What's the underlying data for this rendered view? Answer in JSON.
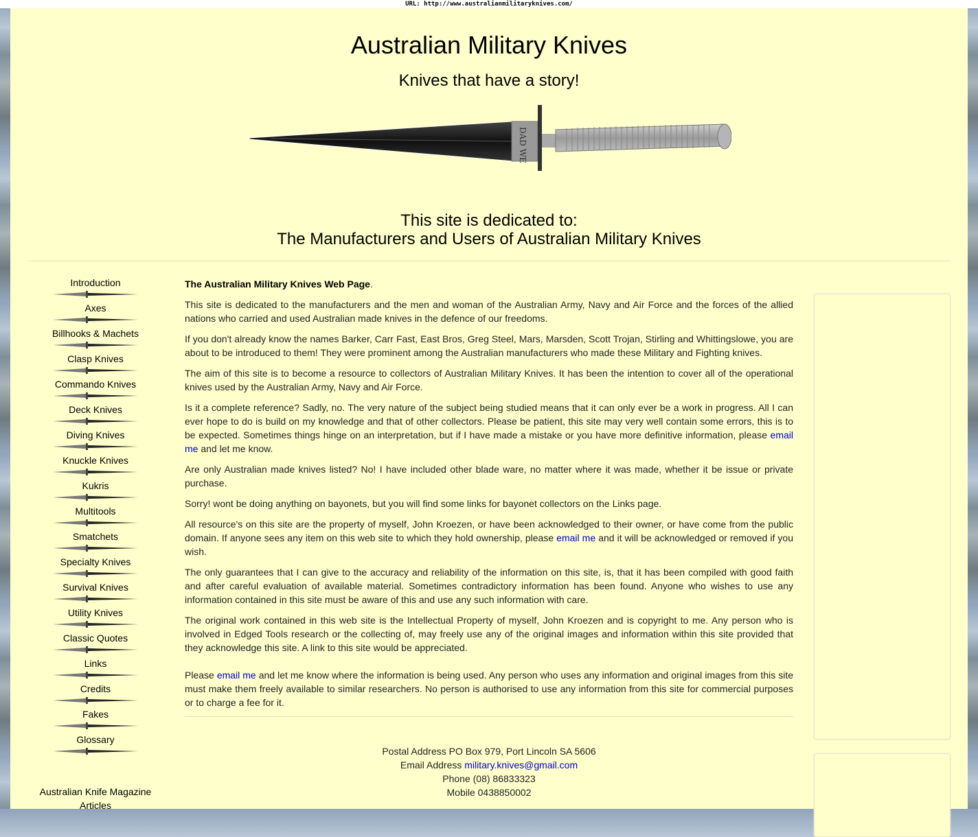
{
  "url_bar": "URL: http://www.australianmilitaryknives.com/",
  "header": {
    "title": "Australian Military Knives",
    "subtitle": "Knives that have a story!",
    "knife_etching": "DAD WE",
    "dedication_line1": "This site is dedicated to:",
    "dedication_line2": "The Manufacturers and Users of Australian Military Knives"
  },
  "sidebar": {
    "items": [
      {
        "label": "Introduction"
      },
      {
        "label": "Axes"
      },
      {
        "label": "Billhooks & Machets"
      },
      {
        "label": "Clasp Knives"
      },
      {
        "label": "Commando Knives"
      },
      {
        "label": "Deck Knives"
      },
      {
        "label": "Diving Knives"
      },
      {
        "label": "Knuckle Knives"
      },
      {
        "label": "Kukris"
      },
      {
        "label": "Multitools"
      },
      {
        "label": "Smatchets"
      },
      {
        "label": "Specialty Knives"
      },
      {
        "label": "Survival Knives"
      },
      {
        "label": "Utility Knives"
      },
      {
        "label": "Classic Quotes"
      },
      {
        "label": "Links"
      },
      {
        "label": "Credits"
      },
      {
        "label": "Fakes"
      },
      {
        "label": "Glossary"
      }
    ],
    "extra_link": "Australian Knife Magazine Articles"
  },
  "content": {
    "intro_bold": "The Australian Military Knives Web Page",
    "intro_dot": ".",
    "p1": "This site is dedicated to the manufacturers and the men and woman of the Australian Army, Navy and Air Force and the forces of the allied nations who carried and used Australian made knives in the defence of our freedoms.",
    "p2": "If you don't already know the names Barker, Carr Fast, East Bros, Greg Steel, Mars, Marsden, Scott Trojan, Stirling and Whittingslowe, you are about to be introduced to them! They were prominent among the Australian manufacturers who made these Military and Fighting knives.",
    "p3": "The aim of this site is to become a resource to collectors of Australian Military Knives. It has been the intention to cover all of the operational knives used by the Australian Army, Navy and Air Force.",
    "p4_pre": "Is it a complete reference? Sadly, no. The very nature of the subject being studied means that it can only ever be a work in progress. All I can ever hope to do is build on my knowledge and that of other collectors. Please be patient, this site may very well contain some errors, this is to be expected. Sometimes things hinge on an interpretation, but if I have made a mistake or you have more definitive information, please ",
    "p4_link": "email me",
    "p4_post": " and let me know.",
    "p5": "Are only Australian made knives listed? No! I have included other blade ware, no matter where it was made, whether it be issue or private purchase.",
    "p6": "Sorry! wont be doing anything on bayonets, but you will find some links for bayonet collectors on the Links page.",
    "p7_pre": "All resource's on this site are the property of myself, John Kroezen, or have been acknowledged to their owner, or have come from the public domain. If anyone sees any item on this web site to which they hold ownership, please ",
    "p7_link": "email me",
    "p7_post": " and it will be acknowledged or removed if you wish.",
    "p8": "The only guarantees that I can give to the accuracy and reliability of the information on this site, is, that it has been compiled with good faith and after careful evaluation of available material. Sometimes contradictory information has been found. Anyone who wishes to use any information contained in this site must be aware of this and use any such information with care.",
    "p9": "The original work contained in this web site is the Intellectual Property of myself, John Kroezen and is copyright to me. Any person who is involved in Edged Tools research or the collecting of, may freely use any of the original images and information within this site provided that they acknowledge this site. A link to this site would be appreciated.",
    "p10_pre": "Please ",
    "p10_link": "email me",
    "p10_post": " and let me know where the information is being used. Any person who uses any information and original images from this site must make them freely available to similar researchers. No person is authorised to use any information from this site for commercial purposes or to charge a fee for it."
  },
  "contact": {
    "postal": "Postal Address PO Box 979, Port Lincoln SA 5606",
    "email_label": "Email Address ",
    "email": "military.knives@gmail.com",
    "phone": "Phone (08) 86833323",
    "mobile": "Mobile 0438850002"
  },
  "colors": {
    "page_bg": "#ffffcc",
    "link": "#0000cc",
    "text": "#222222"
  }
}
